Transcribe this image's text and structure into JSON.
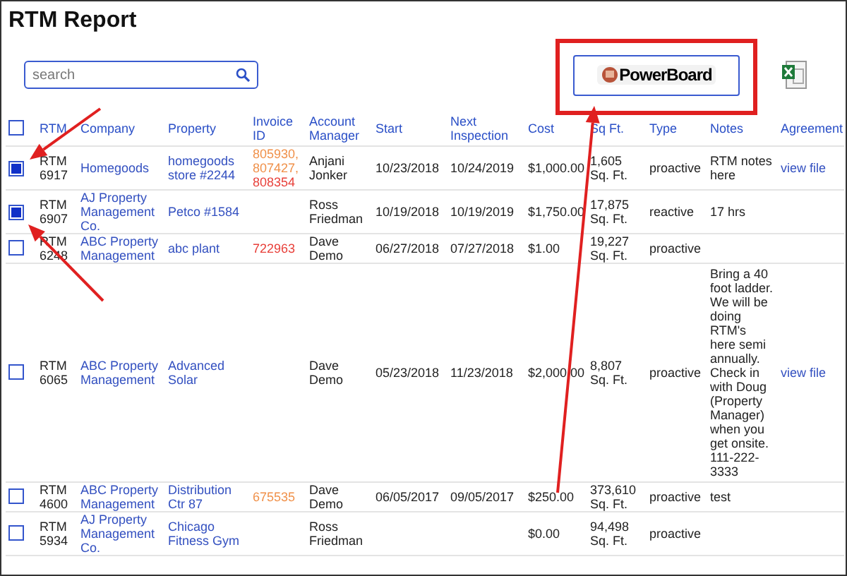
{
  "title": "RTM Report",
  "search": {
    "placeholder": "search"
  },
  "powerboard_button": {
    "label": "PowerBoard"
  },
  "table": {
    "columns": [
      "RTM",
      "Company",
      "Property",
      "Invoice ID",
      "Account Manager",
      "Start",
      "Next Inspection",
      "Cost",
      "Sq Ft.",
      "Type",
      "Notes",
      "Agreement"
    ],
    "select_all": {
      "checked": false
    },
    "rows": [
      {
        "selected": true,
        "rtm": "RTM 6917",
        "company": "Homegoods",
        "property": "homegoods store #2244",
        "invoices": [
          {
            "id": "805930,",
            "color": "#f0914a"
          },
          {
            "id": "807427,",
            "color": "#f0914a"
          },
          {
            "id": "808354",
            "color": "#e8403a"
          }
        ],
        "manager": "Anjani Jonker",
        "start": "10/23/2018",
        "next": "10/24/2019",
        "cost": "$1,000.00",
        "sqft": "1,605 Sq. Ft.",
        "type": "proactive",
        "notes": "RTM notes here",
        "agreement": "view file"
      },
      {
        "selected": true,
        "rtm": "RTM 6907",
        "company": "AJ Property Management Co.",
        "property": "Petco #1584",
        "invoices": [],
        "manager": "Ross Friedman",
        "start": "10/19/2018",
        "next": "10/19/2019",
        "cost": "$1,750.00",
        "sqft": "17,875 Sq. Ft.",
        "type": "reactive",
        "notes": "17 hrs"
      },
      {
        "selected": false,
        "rtm": "RTM 6248",
        "company": "ABC Property Management",
        "property": "abc plant",
        "invoices": [
          {
            "id": "722963",
            "color": "#e8403a"
          }
        ],
        "manager": "Dave Demo",
        "start": "06/27/2018",
        "next": "07/27/2018",
        "cost": "$1.00",
        "sqft": "19,227 Sq. Ft.",
        "type": "proactive"
      },
      {
        "selected": false,
        "rtm": "RTM 6065",
        "company": "ABC Property Management",
        "property": "Advanced Solar",
        "invoices": [],
        "manager": "Dave Demo",
        "start": "05/23/2018",
        "next": "11/23/2018",
        "cost": "$2,000.00",
        "sqft": "8,807 Sq. Ft.",
        "type": "proactive",
        "notes": "Bring a 40 foot ladder. We will be doing RTM's here semi annually. Check in with Doug (Property Manager) when you get onsite. 111-222-3333",
        "agreement": "view file"
      },
      {
        "selected": false,
        "rtm": "RTM 4600",
        "company": "ABC Property Management",
        "property": "Distribution Ctr 87",
        "invoices": [
          {
            "id": "675535",
            "color": "#f0914a"
          }
        ],
        "manager": "Dave Demo",
        "start": "06/05/2017",
        "next": "09/05/2017",
        "cost": "$250.00",
        "sqft": "373,610 Sq. Ft.",
        "type": "proactive",
        "notes": "test"
      },
      {
        "selected": false,
        "rtm": "RTM 5934",
        "company": "AJ Property Management Co.",
        "property": "Chicago Fitness Gym",
        "invoices": [],
        "manager": "Ross Friedman",
        "cost": "$0.00",
        "sqft": "94,498 Sq. Ft.",
        "type": "proactive"
      }
    ]
  }
}
